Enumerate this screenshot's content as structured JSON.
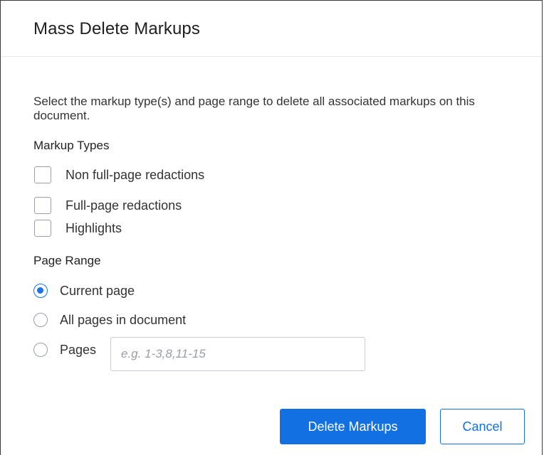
{
  "dialog": {
    "title": "Mass Delete Markups",
    "intro": "Select the markup type(s) and page range to delete all associated markups on this document."
  },
  "markup_types": {
    "label": "Markup Types",
    "options": [
      {
        "label": "Non full-page redactions",
        "checked": false
      },
      {
        "label": "Full-page redactions",
        "checked": false
      },
      {
        "label": "Highlights",
        "checked": false
      }
    ]
  },
  "page_range": {
    "label": "Page Range",
    "options": [
      {
        "label": "Current page",
        "selected": true
      },
      {
        "label": "All pages in document",
        "selected": false
      },
      {
        "label": "Pages",
        "selected": false
      }
    ],
    "pages_input": {
      "value": "",
      "placeholder": "e.g. 1-3,8,11-15"
    }
  },
  "actions": {
    "delete_label": "Delete Markups",
    "cancel_label": "Cancel"
  },
  "colors": {
    "accent": "#1270e3"
  }
}
